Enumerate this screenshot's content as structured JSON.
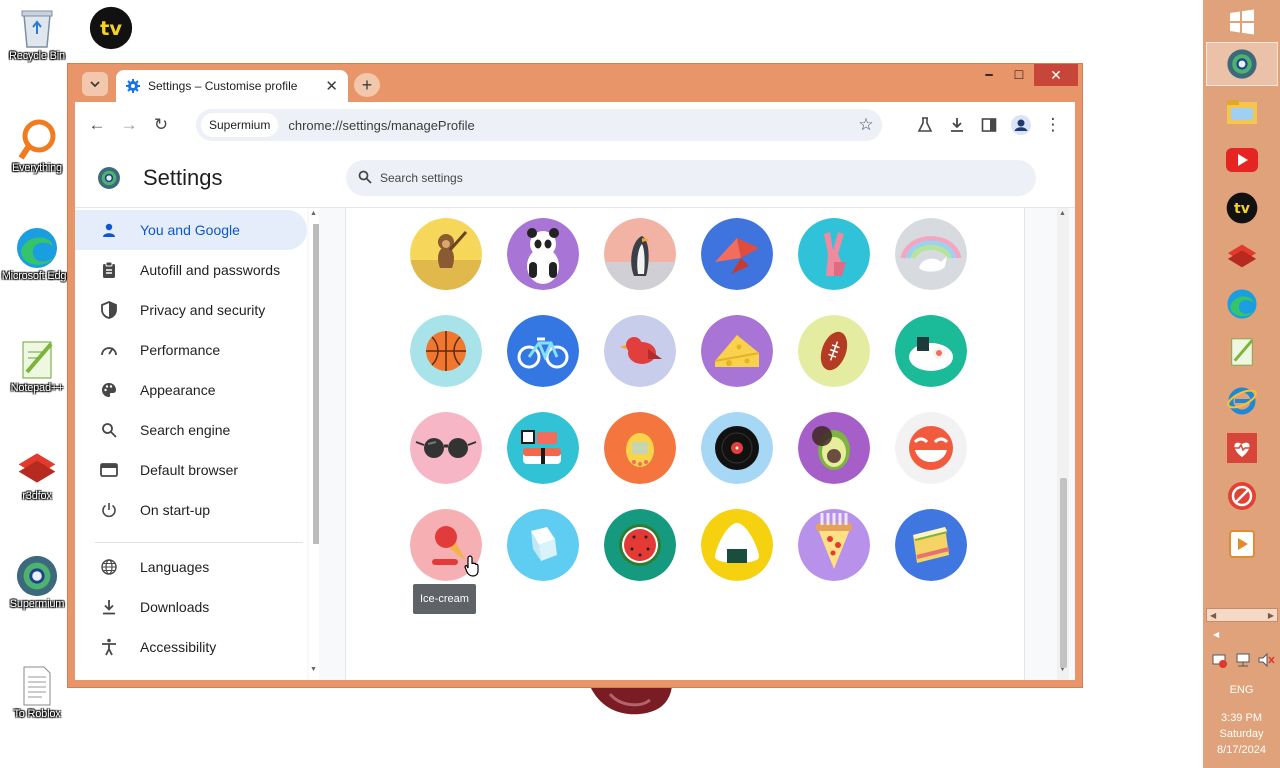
{
  "desktop": {
    "icons": [
      {
        "label": "Recycle Bin",
        "icon": "recycle-bin-icon"
      },
      {
        "label": "",
        "icon": "tv-app-icon"
      },
      {
        "label": "Everything",
        "icon": "everything-search-icon"
      },
      {
        "label": "Microsoft Edge",
        "icon": "edge-icon"
      },
      {
        "label": "Notepad++",
        "icon": "notepad-plus-icon"
      },
      {
        "label": "r3dfox",
        "icon": "r3dfox-icon"
      },
      {
        "label": "Supermium",
        "icon": "supermium-icon"
      },
      {
        "label": "To Roblox",
        "icon": "text-file-icon"
      }
    ]
  },
  "taskbar": {
    "items": [
      "start-icon",
      "supermium-icon",
      "file-explorer-icon",
      "youtube-icon",
      "tv-app-icon",
      "r3dfox-icon",
      "edge-icon",
      "notepad-plus-icon",
      "internet-explorer-icon",
      "health-app-icon",
      "blocked-app-icon",
      "media-player-icon"
    ],
    "language": "ENG",
    "time": "3:39 PM",
    "day": "Saturday",
    "date": "8/17/2024"
  },
  "browser": {
    "tab_title": "Settings – Customise profile",
    "profile_chip": "Supermium",
    "url": "chrome://settings/manageProfile"
  },
  "settings": {
    "title": "Settings",
    "search_placeholder": "Search settings",
    "nav": [
      {
        "label": "You and Google",
        "icon": "person-icon",
        "active": true
      },
      {
        "label": "Autofill and passwords",
        "icon": "clipboard-icon"
      },
      {
        "label": "Privacy and security",
        "icon": "shield-icon"
      },
      {
        "label": "Performance",
        "icon": "speedometer-icon"
      },
      {
        "label": "Appearance",
        "icon": "palette-icon"
      },
      {
        "label": "Search engine",
        "icon": "search-icon"
      },
      {
        "label": "Default browser",
        "icon": "browser-window-icon"
      },
      {
        "label": "On start-up",
        "icon": "power-icon"
      },
      {
        "label": "Languages",
        "icon": "globe-icon"
      },
      {
        "label": "Downloads",
        "icon": "download-icon"
      },
      {
        "label": "Accessibility",
        "icon": "accessibility-icon"
      }
    ],
    "tooltip": "Ice-cream",
    "avatars": [
      {
        "name": "monkey",
        "bg": "#f6d75a"
      },
      {
        "name": "panda",
        "bg": "#a874d6"
      },
      {
        "name": "penguin",
        "bg": "#f2b3a5"
      },
      {
        "name": "origami-bird",
        "bg": "#3f73dd"
      },
      {
        "name": "rabbit",
        "bg": "#30c2d8"
      },
      {
        "name": "unicorn",
        "bg": "#d7dbe0"
      },
      {
        "name": "basketball",
        "bg": "#a9e3ea"
      },
      {
        "name": "bicycle",
        "bg": "#3477e3"
      },
      {
        "name": "bird",
        "bg": "#c9cdec"
      },
      {
        "name": "cheese",
        "bg": "#a874d6"
      },
      {
        "name": "football",
        "bg": "#e4eca2"
      },
      {
        "name": "sushi-plate",
        "bg": "#1bbb9a"
      },
      {
        "name": "sunglasses",
        "bg": "#f6b6c6"
      },
      {
        "name": "sushi",
        "bg": "#31c3d5"
      },
      {
        "name": "tamagotchi",
        "bg": "#f4763e"
      },
      {
        "name": "vinyl",
        "bg": "#a6d7f5"
      },
      {
        "name": "avocado",
        "bg": "#a65fc8"
      },
      {
        "name": "smile",
        "bg": "#f2f2f2"
      },
      {
        "name": "ice-cream",
        "bg": "#f6b0b3"
      },
      {
        "name": "ice-cube",
        "bg": "#5fccf1"
      },
      {
        "name": "watermelon",
        "bg": "#159a7f"
      },
      {
        "name": "onigiri",
        "bg": "#f6d10f"
      },
      {
        "name": "pizza",
        "bg": "#b791ea"
      },
      {
        "name": "sandwich",
        "bg": "#3f76e0"
      }
    ]
  }
}
